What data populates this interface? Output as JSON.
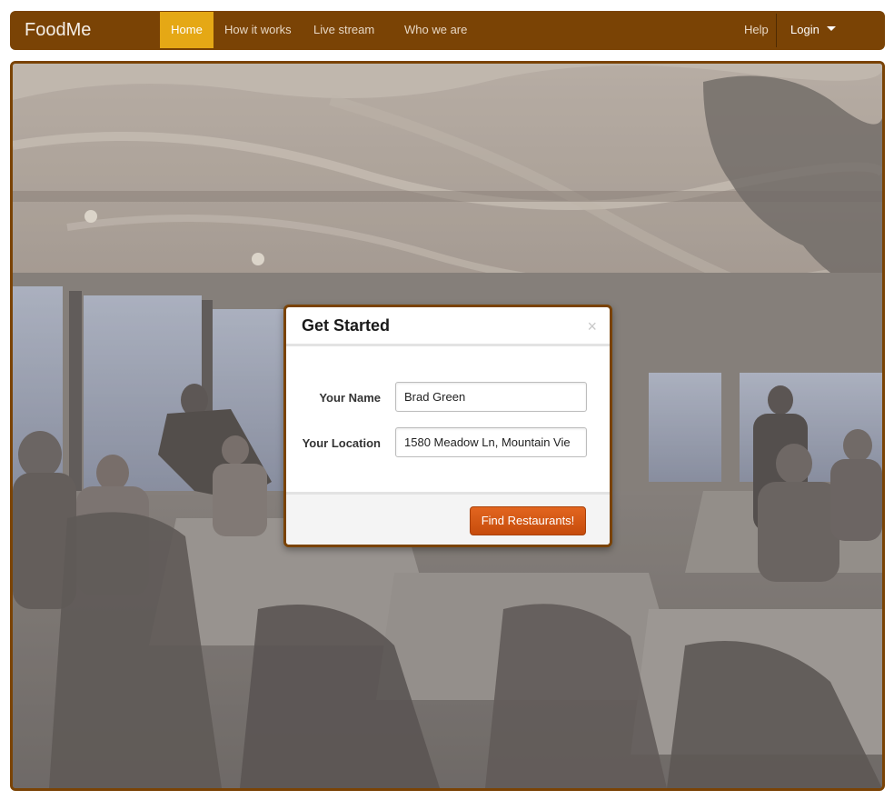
{
  "navbar": {
    "brand": "FoodMe",
    "items": [
      {
        "label": "Home",
        "active": true
      },
      {
        "label": "How it works"
      },
      {
        "label": "Live stream"
      },
      {
        "label": "Who we are"
      }
    ],
    "help_label": "Help",
    "login_label": "Login",
    "colors": {
      "bar": "#7a4305",
      "active": "#e5a815"
    }
  },
  "modal": {
    "title": "Get Started",
    "close_symbol": "×",
    "name_label": "Your Name",
    "name_value": "Brad Green",
    "location_label": "Your Location",
    "location_value": "1580 Meadow Ln, Mountain Vie",
    "submit_label": "Find Restaurants!",
    "colors": {
      "button": "#d9561a",
      "border": "#7a4305"
    }
  },
  "background": {
    "subject": "restaurant-dining-room-photo"
  }
}
